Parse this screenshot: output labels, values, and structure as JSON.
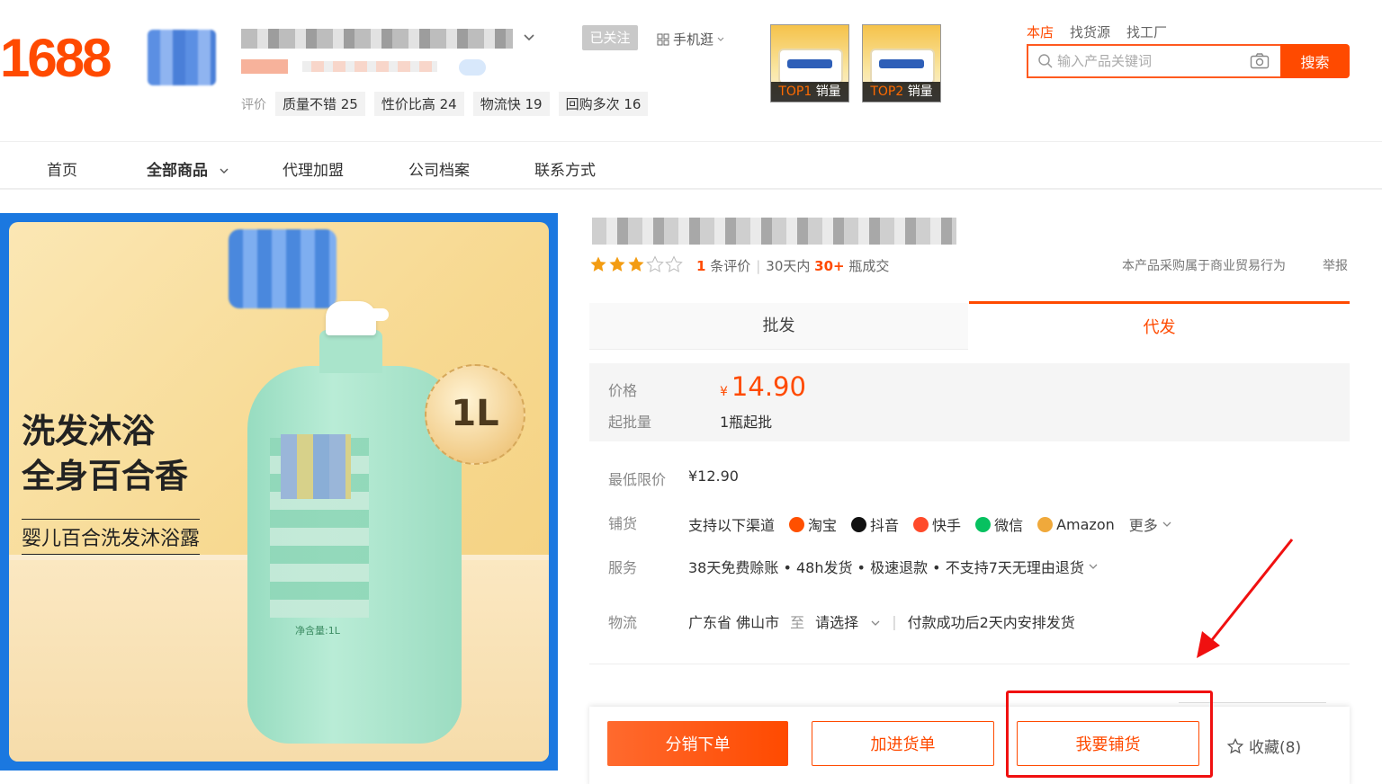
{
  "brand": {
    "logo_text": "1688"
  },
  "shop": {
    "follow_label": "已关注",
    "mobile_label": "手机逛",
    "rating_label": "评价",
    "tags": [
      "质量不错 25",
      "性价比高 24",
      "物流快 19",
      "回购多次 16"
    ]
  },
  "badges": [
    {
      "rank": "TOP1",
      "text": "销量"
    },
    {
      "rank": "TOP2",
      "text": "销量"
    }
  ],
  "search": {
    "tabs": [
      "本店",
      "找货源",
      "找工厂"
    ],
    "placeholder": "输入产品关键词",
    "button": "搜索"
  },
  "nav": {
    "items": [
      "首页",
      "全部商品",
      "代理加盟",
      "公司档案",
      "联系方式"
    ]
  },
  "gallery": {
    "headline_1": "洗发沐浴",
    "headline_2": "全身百合香",
    "subtitle": "婴儿百合洗发沐浴露",
    "volume": "1L",
    "net_content": "净含量:1L"
  },
  "product": {
    "stars": 3,
    "stars_max": 5,
    "review_count": "1",
    "review_suffix": "条评价",
    "sold_prefix": "30天内",
    "sold_count": "30+",
    "sold_suffix": "瓶成交",
    "trade_note": "本产品采购属于商业贸易行为",
    "report": "举报"
  },
  "tabs": {
    "wholesale": "批发",
    "dropship": "代发"
  },
  "price": {
    "label": "价格",
    "currency": "¥",
    "amount": "14.90",
    "moq_label": "起批量",
    "moq_value": "1瓶起批"
  },
  "details": {
    "min_price_label": "最低限价",
    "min_price_value": "¥12.90",
    "channel_label": "铺货",
    "channel_intro": "支持以下渠道",
    "channels": [
      {
        "name": "淘宝",
        "color": "#ff5000"
      },
      {
        "name": "抖音",
        "color": "#111111"
      },
      {
        "name": "快手",
        "color": "#ff4a2a"
      },
      {
        "name": "微信",
        "color": "#07c160"
      },
      {
        "name": "Amazon",
        "color": "#f0a93b"
      }
    ],
    "more": "更多",
    "service_label": "服务",
    "services": "38天免费赊账 • 48h发货 • 极速退款 • 不支持7天无理由退货",
    "logistics_label": "物流",
    "origin": "广东省 佛山市",
    "to": "至",
    "destination": "请选择",
    "ship_note": "付款成功后2天内安排发货"
  },
  "actions": {
    "order": "分销下单",
    "add_cart": "加进货单",
    "distribute": "我要铺货",
    "favorite": "收藏(8)"
  },
  "colors": {
    "accent": "#ff4a00",
    "annotation": "#f01010",
    "gallery_border": "#1b78e0"
  }
}
